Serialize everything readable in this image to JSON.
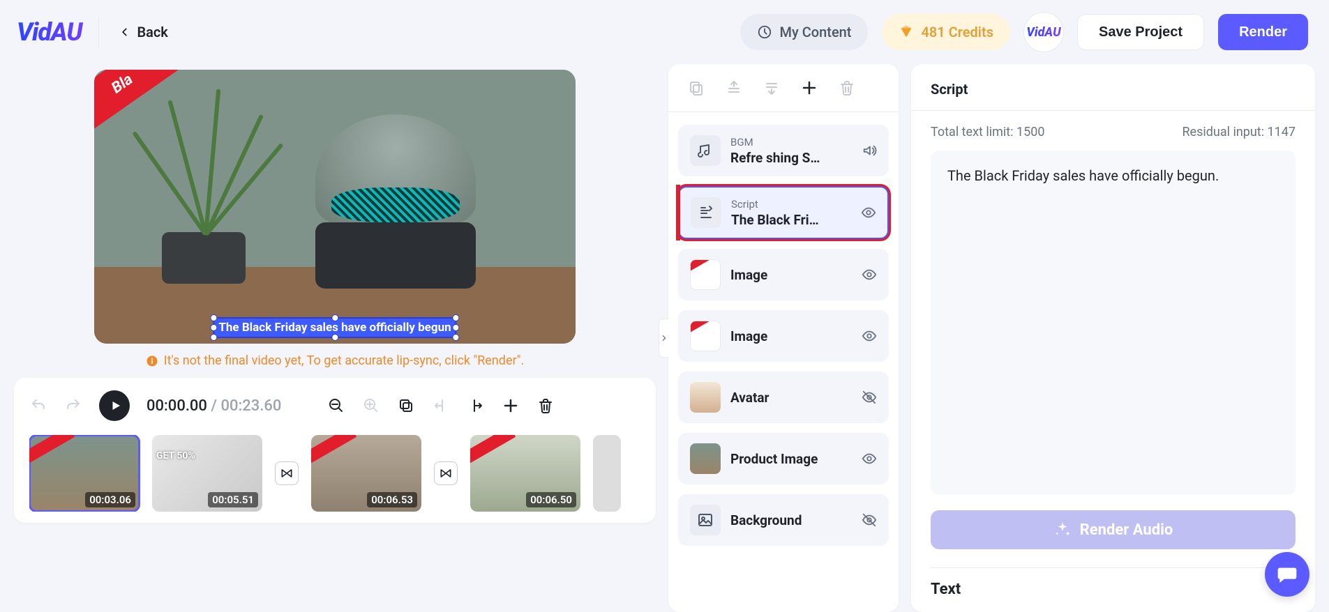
{
  "header": {
    "logo": "VidAU",
    "back": "Back",
    "my_content": "My Content",
    "credits": "481 Credits",
    "badge_logo": "VidAU",
    "save": "Save Project",
    "render": "Render"
  },
  "preview": {
    "ribbon": "Bla",
    "caption": "The Black Friday sales have officially begun",
    "hint": "It's not the final video yet, To get accurate lip-sync, click \"Render\"."
  },
  "timeline": {
    "current": "00:00.00",
    "sep": " / ",
    "duration": "00:23.60",
    "clips": [
      {
        "dur": "00:03.06"
      },
      {
        "dur": "00:05.51"
      },
      {
        "dur": "00:06.53"
      },
      {
        "dur": "00:06.50"
      }
    ]
  },
  "layers": {
    "bgm": {
      "label": "BGM",
      "value": "Refre shing S…"
    },
    "script": {
      "label": "Script",
      "value": "The Black Fri…"
    },
    "image1": {
      "value": "Image"
    },
    "image2": {
      "value": "Image"
    },
    "avatar": {
      "value": "Avatar"
    },
    "product": {
      "value": "Product Image"
    },
    "background": {
      "value": "Background"
    }
  },
  "script_panel": {
    "title": "Script",
    "limit_label": "Total text limit: ",
    "limit_value": "1500",
    "residual_label": "Residual input: ",
    "residual_value": "1147",
    "text": "The Black Friday sales have officially begun.",
    "render_audio": "Render Audio",
    "text_section": "Text"
  }
}
